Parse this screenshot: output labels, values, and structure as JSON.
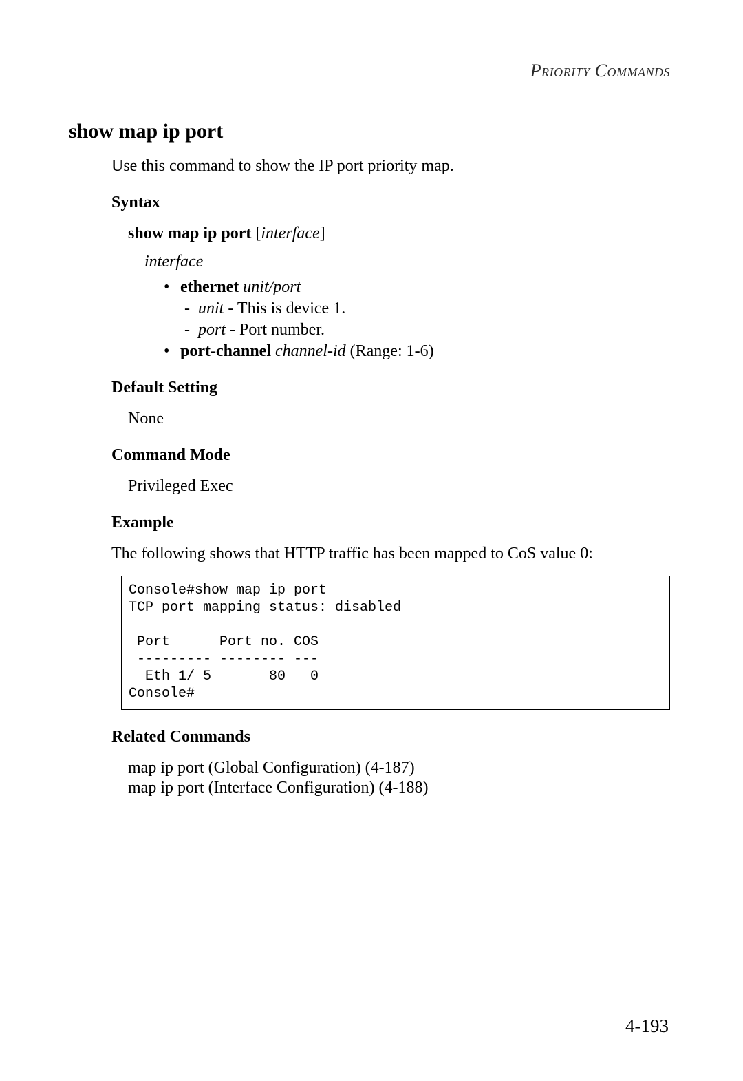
{
  "header": "Priority Commands",
  "title": "show map ip port",
  "description": "Use this command to show the IP port priority map.",
  "syntax": {
    "heading": "Syntax",
    "command_bold": "show map ip port",
    "command_param": "interface",
    "interface_label": "interface",
    "ethernet": {
      "keyword": "ethernet",
      "param": "unit/port",
      "unit_name": "unit",
      "unit_desc": " - This is device 1.",
      "port_name": "port",
      "port_desc": " - Port number."
    },
    "portchannel": {
      "keyword": "port-channel",
      "param": "channel-id",
      "range": " (Range: 1-6)"
    }
  },
  "default_setting": {
    "heading": "Default Setting",
    "value": "None"
  },
  "command_mode": {
    "heading": "Command Mode",
    "value": "Privileged Exec"
  },
  "example": {
    "heading": "Example",
    "desc": "The following shows that HTTP traffic has been mapped to CoS value 0:",
    "code": "Console#show map ip port\nTCP port mapping status: disabled\n\n Port      Port no. COS\n --------- -------- ---\n  Eth 1/ 5       80   0\nConsole#"
  },
  "related": {
    "heading": "Related Commands",
    "line1": "map ip port (Global Configuration) (4-187)",
    "line2": "map ip port (Interface Configuration) (4-188)"
  },
  "page_number": "4-193"
}
